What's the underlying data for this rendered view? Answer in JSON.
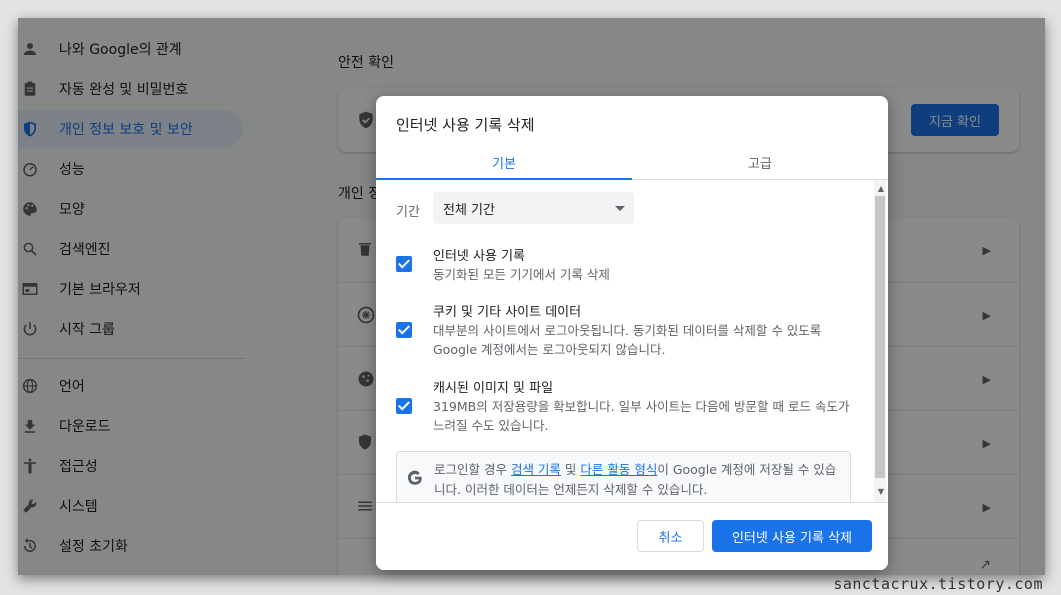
{
  "sidebar": {
    "items": [
      {
        "label": "나와 Google의 관계",
        "icon": "person-icon"
      },
      {
        "label": "자동 완성 및 비밀번호",
        "icon": "clipboard-icon"
      },
      {
        "label": "개인 정보 보호 및 보안",
        "icon": "shield-icon",
        "active": true
      },
      {
        "label": "성능",
        "icon": "speedometer-icon"
      },
      {
        "label": "모양",
        "icon": "palette-icon"
      },
      {
        "label": "검색엔진",
        "icon": "search-icon"
      },
      {
        "label": "기본 브라우저",
        "icon": "browser-icon"
      },
      {
        "label": "시작 그룹",
        "icon": "power-icon"
      },
      {
        "label": "언어",
        "icon": "globe-icon"
      },
      {
        "label": "다운로드",
        "icon": "download-icon"
      },
      {
        "label": "접근성",
        "icon": "accessibility-icon"
      },
      {
        "label": "시스템",
        "icon": "wrench-icon"
      },
      {
        "label": "설정 초기화",
        "icon": "reset-icon"
      }
    ]
  },
  "main": {
    "safety_title": "안전 확인",
    "safety_button": "지금 확인",
    "privacy_title": "개인 정"
  },
  "dialog": {
    "title": "인터넷 사용 기록 삭제",
    "tabs": [
      "기본",
      "고급"
    ],
    "time_range_label": "기간",
    "time_range_value": "전체 기간",
    "options": [
      {
        "title": "인터넷 사용 기록",
        "desc": "동기화된 모든 기기에서 기록 삭제",
        "checked": true
      },
      {
        "title": "쿠키 및 기타 사이트 데이터",
        "desc": "대부분의 사이트에서 로그아웃됩니다. 동기화된 데이터를 삭제할 수 있도록 Google 계정에서는 로그아웃되지 않습니다.",
        "checked": true
      },
      {
        "title": "캐시된 이미지 및 파일",
        "desc": "319MB의 저장용량을 확보합니다. 일부 사이트는 다음에 방문할 때 로드 속도가 느려질 수도 있습니다.",
        "checked": true
      }
    ],
    "notice": {
      "prefix": "로그인할 경우 ",
      "link1": "검색 기록",
      "mid": " 및 ",
      "link2": "다른 활동 형식",
      "suffix": "이 Google 계정에 저장될 수 있습니다. 이러한 데이터는 언제든지 삭제할 수 있습니다."
    },
    "cancel_label": "취소",
    "delete_label": "인터넷 사용 기록 삭제"
  },
  "watermark": "sanctacrux.tistory.com",
  "colors": {
    "accent": "#1a73e8",
    "scrim": "#000000"
  }
}
